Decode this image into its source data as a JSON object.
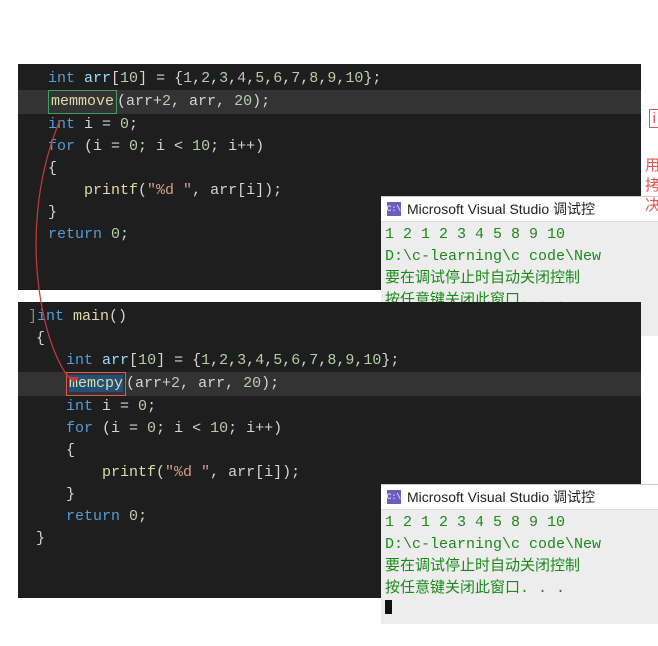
{
  "top_code": {
    "l1": {
      "t1": "int",
      "t2": " arr",
      "t3": "[",
      "t4": "10",
      "t5": "] = {",
      "t6": "1",
      "t7": ",",
      "t8": "2",
      "t9": ",",
      "t10": "3",
      "t11": ",",
      "t12": "4",
      "t13": ",",
      "t14": "5",
      "t15": ",",
      "t16": "6",
      "t17": ",",
      "t18": "7",
      "t19": ",",
      "t20": "8",
      "t21": ",",
      "t22": "9",
      "t23": ",",
      "t24": "10",
      "t25": "};"
    },
    "l2": {
      "fn": "memmove",
      "args1": "(arr+",
      "n1": "2",
      "args2": ", arr, ",
      "n2": "20",
      "args3": ");"
    },
    "l3": {
      "kw": "int",
      "sp": " i = ",
      "n": "0",
      "end": ";"
    },
    "l4": {
      "kw": "for",
      "a": " (i = ",
      "n0": "0",
      "b": "; i < ",
      "n1": "10",
      "c": "; i++)"
    },
    "l5": "{",
    "l6": {
      "fn": "printf",
      "a": "(",
      "s": "\"%d \"",
      "b": ", arr[i]);"
    },
    "l7": "}",
    "l8": {
      "kw": "return",
      "sp": " ",
      "n": "0",
      "end": ";"
    }
  },
  "bottom_code": {
    "l0a": {
      "kw": "int",
      "fn": " main",
      "p": "()"
    },
    "l0b": "{",
    "l1": {
      "t1": "int",
      "t2": " arr",
      "t3": "[",
      "t4": "10",
      "t5": "] = {",
      "t6": "1",
      "t7": ",",
      "t8": "2",
      "t9": ",",
      "t10": "3",
      "t11": ",",
      "t12": "4",
      "t13": ",",
      "t14": "5",
      "t15": ",",
      "t16": "6",
      "t17": ",",
      "t18": "7",
      "t19": ",",
      "t20": "8",
      "t21": ",",
      "t22": "9",
      "t23": ",",
      "t24": "10",
      "t25": "};"
    },
    "l2": {
      "fn": "memcpy",
      "args1": "(arr+",
      "n1": "2",
      "args2": ", arr, ",
      "n2": "20",
      "args3": ");"
    },
    "l3": {
      "kw": "int",
      "sp": " i = ",
      "n": "0",
      "end": ";"
    },
    "l4": {
      "kw": "for",
      "a": " (i = ",
      "n0": "0",
      "b": "; i < ",
      "n1": "10",
      "c": "; i++)"
    },
    "l5": "{",
    "l6": {
      "fn": "printf",
      "a": "(",
      "s": "\"%d \"",
      "b": ", arr[i]);"
    },
    "l7": "}",
    "l8": {
      "kw": "return",
      "sp": " ",
      "n": "0",
      "end": ";"
    },
    "l9": "}"
  },
  "console_top": {
    "title": "Microsoft Visual Studio 调试控",
    "icon": "C:\\",
    "out1": "1 2 1 2 3 4 5 8 9 10",
    "out2": "D:\\c-learning\\c code\\New ",
    "out3": "要在调试停止时自动关闭控制",
    "out4": "按任意键关闭此窗口. . ."
  },
  "console_bottom": {
    "title": "Microsoft Visual Studio 调试控",
    "icon": "C:\\",
    "out1": "1 2 1 2 3 4 5 8 9 10",
    "out2": "D:\\c-learning\\c code\\New ",
    "out3": "要在调试停止时自动关闭控制",
    "out4": "按任意键关闭此窗口. . ."
  },
  "side": {
    "i": "i",
    "t1": "用",
    "t2": "拷",
    "t3": "决"
  }
}
